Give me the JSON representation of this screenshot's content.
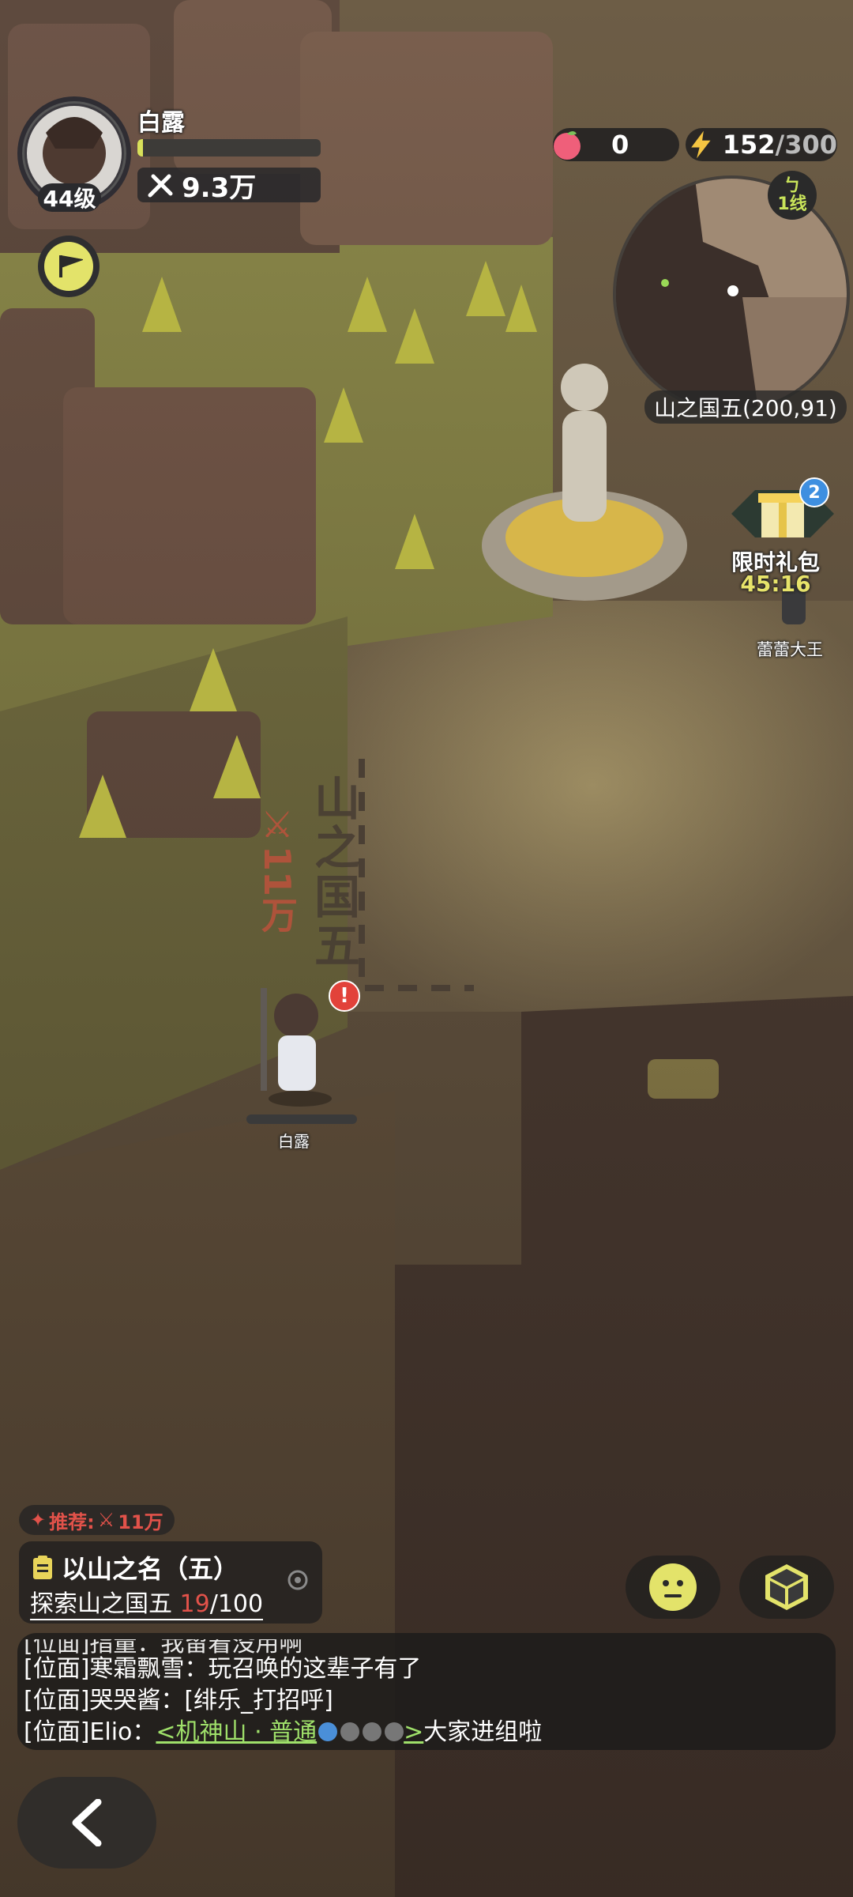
{
  "player": {
    "name": "白露",
    "level": "44级",
    "power": "9.3万",
    "hp_fraction": 0.03
  },
  "resources": {
    "peach": "0",
    "energy_current": "152",
    "energy_max": "/300"
  },
  "minimap": {
    "line_icon": "ㄅ",
    "line_label": "1线",
    "location": "山之国五(200,91)"
  },
  "gift": {
    "badge_count": "2",
    "label": "限时礼包",
    "timer": "45:16"
  },
  "npc": {
    "name": "蕾蕾大王"
  },
  "zone": {
    "name": "山之国五",
    "power": "11万"
  },
  "character": {
    "name": "白露",
    "alert": "!"
  },
  "quest": {
    "recommend_label": "推荐:",
    "recommend_power": "11万",
    "title": "以山之名（五）",
    "sub_prefix": "探索山之国五 ",
    "sub_current": "19",
    "sub_total": "/100"
  },
  "chat": {
    "line0": "[位面]指量：我留着没用啊",
    "line1": "[位面]寒霜飘雪：玩召唤的这辈子有了",
    "line2": "[位面]哭哭酱：[绯乐_打招呼]",
    "line3_prefix": "[位面]Elio：",
    "line3_link": "<机神山 · 普通",
    "line3_link_end": ">",
    "line3_suffix": "大家进组啦"
  },
  "colors": {
    "accent_yellow": "#e3e36a",
    "accent_red": "#e2524a",
    "link_green": "#9fe06a",
    "panel_bg": "#232120"
  },
  "icons": [
    "avatar",
    "guild-flag-icon",
    "power-icon",
    "peach-icon",
    "lightning-icon",
    "gift-icon",
    "quest-icon",
    "target-icon",
    "emoji-icon",
    "cube-icon",
    "back-arrow-icon"
  ]
}
